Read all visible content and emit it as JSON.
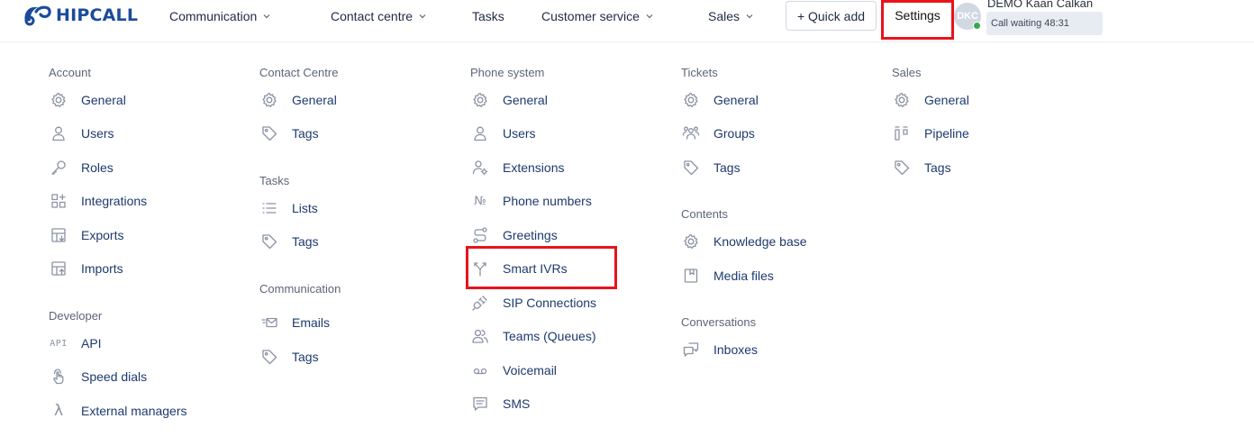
{
  "header": {
    "logo_text": "HIPCALL",
    "nav": [
      {
        "label": "Communication",
        "has_dropdown": true
      },
      {
        "label": "Contact centre",
        "has_dropdown": true
      },
      {
        "label": "Tasks",
        "has_dropdown": false
      },
      {
        "label": "Customer service",
        "has_dropdown": true
      },
      {
        "label": "Sales",
        "has_dropdown": true
      }
    ],
    "quick_add_label": "+ Quick add",
    "settings_label": "Settings",
    "user": {
      "initials": "DKC",
      "name": "DEMO Kaan Calkan",
      "call_status": "Call waiting 48:31"
    }
  },
  "menu": {
    "account": {
      "title": "Account",
      "items": [
        {
          "label": "General",
          "icon": "gear-icon"
        },
        {
          "label": "Users",
          "icon": "user-icon"
        },
        {
          "label": "Roles",
          "icon": "key-icon"
        },
        {
          "label": "Integrations",
          "icon": "integrations-icon"
        },
        {
          "label": "Exports",
          "icon": "export-icon"
        },
        {
          "label": "Imports",
          "icon": "import-icon"
        }
      ]
    },
    "developer": {
      "title": "Developer",
      "items": [
        {
          "label": "API",
          "icon": "api-icon",
          "icon_text": "API"
        },
        {
          "label": "Speed dials",
          "icon": "tap-icon"
        },
        {
          "label": "External managers",
          "icon": "lambda-icon",
          "icon_text": "λ"
        }
      ]
    },
    "contact_centre": {
      "title": "Contact Centre",
      "items": [
        {
          "label": "General",
          "icon": "gear-icon"
        },
        {
          "label": "Tags",
          "icon": "tag-icon"
        }
      ]
    },
    "tasks": {
      "title": "Tasks",
      "items": [
        {
          "label": "Lists",
          "icon": "list-icon"
        },
        {
          "label": "Tags",
          "icon": "tag-icon"
        }
      ]
    },
    "communication": {
      "title": "Communication",
      "items": [
        {
          "label": "Emails",
          "icon": "email-icon"
        },
        {
          "label": "Tags",
          "icon": "tag-icon"
        }
      ]
    },
    "phone_system": {
      "title": "Phone system",
      "items": [
        {
          "label": "General",
          "icon": "gear-icon"
        },
        {
          "label": "Users",
          "icon": "user-icon"
        },
        {
          "label": "Extensions",
          "icon": "user-gear-icon"
        },
        {
          "label": "Phone numbers",
          "icon": "number-sign-icon",
          "icon_text": "№"
        },
        {
          "label": "Greetings",
          "icon": "route-icon"
        },
        {
          "label": "Smart IVRs",
          "icon": "split-arrow-icon"
        },
        {
          "label": "SIP Connections",
          "icon": "plug-icon"
        },
        {
          "label": "Teams (Queues)",
          "icon": "team-icon"
        },
        {
          "label": "Voicemail",
          "icon": "voicemail-icon"
        },
        {
          "label": "SMS",
          "icon": "chat-icon"
        }
      ]
    },
    "tickets": {
      "title": "Tickets",
      "items": [
        {
          "label": "General",
          "icon": "gear-icon"
        },
        {
          "label": "Groups",
          "icon": "group-icon"
        },
        {
          "label": "Tags",
          "icon": "tag-icon"
        }
      ]
    },
    "contents": {
      "title": "Contents",
      "items": [
        {
          "label": "Knowledge base",
          "icon": "gear-icon"
        },
        {
          "label": "Media files",
          "icon": "media-icon"
        }
      ]
    },
    "conversations": {
      "title": "Conversations",
      "items": [
        {
          "label": "Inboxes",
          "icon": "inbox-chat-icon"
        }
      ]
    },
    "sales": {
      "title": "Sales",
      "items": [
        {
          "label": "General",
          "icon": "gear-icon"
        },
        {
          "label": "Pipeline",
          "icon": "pipeline-icon"
        },
        {
          "label": "Tags",
          "icon": "tag-icon"
        }
      ]
    }
  },
  "colors": {
    "brand": "#1b4b9b",
    "link_text": "#1d3a6e",
    "highlight": "#e8141a",
    "presence": "#36a852"
  }
}
